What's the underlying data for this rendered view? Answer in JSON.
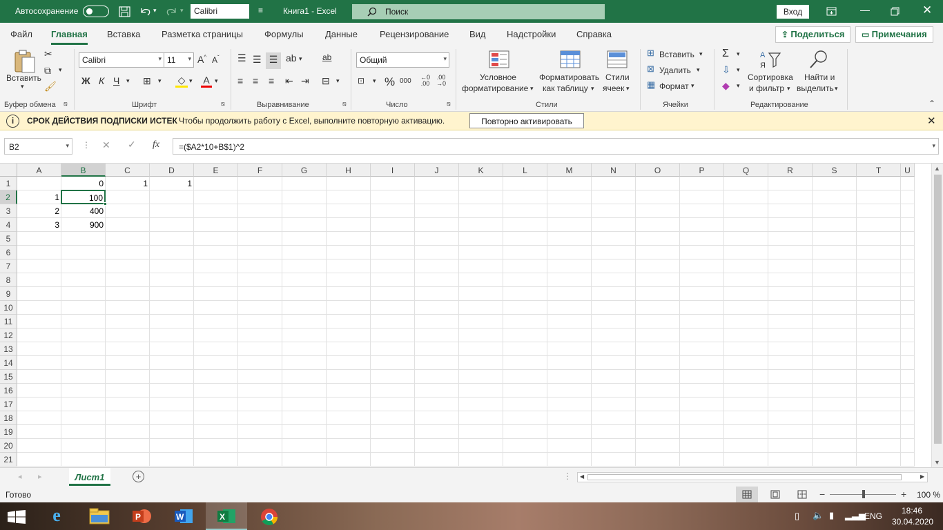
{
  "titlebar": {
    "autosave_label": "Автосохранение",
    "font_name": "Calibri",
    "doc_title": "Книга1  -  Excel",
    "search_label": "Поиск",
    "signin_label": "Вход"
  },
  "menu": {
    "tabs": [
      "Файл",
      "Главная",
      "Вставка",
      "Разметка страницы",
      "Формулы",
      "Данные",
      "Рецензирование",
      "Вид",
      "Надстройки",
      "Справка"
    ],
    "active_tab": "Главная",
    "share_label": "Поделиться",
    "comments_label": "Примечания"
  },
  "ribbon": {
    "clipboard": {
      "paste_label": "Вставить",
      "group": "Буфер обмена"
    },
    "font": {
      "name": "Calibri",
      "size": "11",
      "bold": "Ж",
      "italic": "К",
      "underline": "Ч",
      "group": "Шрифт"
    },
    "alignment": {
      "group": "Выравнивание"
    },
    "number": {
      "format": "Общий",
      "percent": "%",
      "thousands": "000",
      "group": "Число"
    },
    "styles": {
      "conditional_1": "Условное",
      "conditional_2": "форматирование",
      "table_1": "Форматировать",
      "table_2": "как таблицу",
      "cell_1": "Стили",
      "cell_2": "ячеек",
      "group": "Стили"
    },
    "cells": {
      "insert": "Вставить",
      "delete": "Удалить",
      "format": "Формат",
      "group": "Ячейки"
    },
    "editing": {
      "sort_1": "Сортировка",
      "sort_2": "и фильтр",
      "find_1": "Найти и",
      "find_2": "выделить",
      "group": "Редактирование"
    }
  },
  "message_bar": {
    "title": "СРОК ДЕЙСТВИЯ ПОДПИСКИ ИСТЕК",
    "text": "Чтобы продолжить работу с Excel, выполните повторную активацию.",
    "button": "Повторно активировать"
  },
  "formula_bar": {
    "name_box": "B2",
    "formula": "=($A2*10+B$1)^2"
  },
  "sheet": {
    "columns": [
      "A",
      "B",
      "C",
      "D",
      "E",
      "F",
      "G",
      "H",
      "I",
      "J",
      "K",
      "L",
      "M",
      "N",
      "O",
      "P",
      "Q",
      "R",
      "S",
      "T",
      "U"
    ],
    "rows": [
      "1",
      "2",
      "3",
      "4",
      "5",
      "6",
      "7",
      "8",
      "9",
      "10",
      "11",
      "12",
      "13",
      "14",
      "15",
      "16",
      "17",
      "18",
      "19",
      "20",
      "21"
    ],
    "selected_cell": "B2",
    "cells": {
      "B1": "0",
      "C1": "1",
      "D1": "1",
      "A2": "1",
      "B2": "100",
      "A3": "2",
      "B3": "400",
      "A4": "3",
      "B4": "900"
    },
    "tab_name": "Лист1"
  },
  "status": {
    "ready": "Готово",
    "zoom": "100 %"
  },
  "taskbar": {
    "language": "ENG",
    "time": "18:46",
    "date": "30.04.2020"
  }
}
